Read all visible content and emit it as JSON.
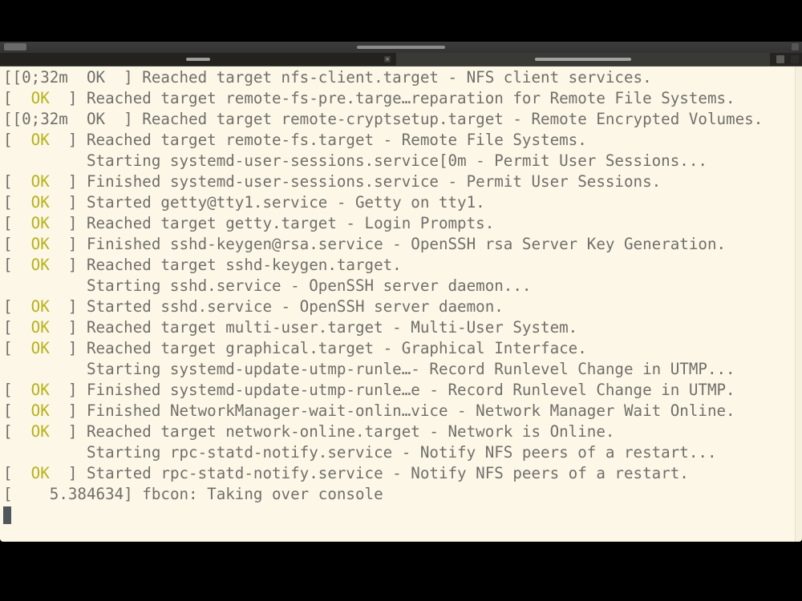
{
  "window": {
    "title": "",
    "tabs": [
      {
        "label": "",
        "active": true
      },
      {
        "label": "",
        "active": false
      }
    ]
  },
  "terminal": {
    "colors": {
      "background": "#fdf7e7",
      "text": "#6f6f6a",
      "ok": "#b6b21c",
      "cursor": "#4f585c"
    },
    "lines": [
      {
        "prefix": "[[0;32m  OK  ] ",
        "ok": "",
        "text": "Reached target nfs-client.target - NFS client services."
      },
      {
        "prefix": "[  ",
        "ok": "OK",
        "text": "  ] Reached target remote-fs-pre.targe…reparation for Remote File Systems."
      },
      {
        "prefix": "[[0;32m  OK  ] ",
        "ok": "",
        "text": "Reached target remote-cryptsetup.target - Remote Encrypted Volumes."
      },
      {
        "prefix": "[  ",
        "ok": "OK",
        "text": "  ] Reached target remote-fs.target - Remote File Systems."
      },
      {
        "prefix": "         ",
        "ok": "",
        "text": "Starting systemd-user-sessions.service[0m - Permit User Sessions..."
      },
      {
        "prefix": "[  ",
        "ok": "OK",
        "text": "  ] Finished systemd-user-sessions.service - Permit User Sessions."
      },
      {
        "prefix": "[  ",
        "ok": "OK",
        "text": "  ] Started getty@tty1.service - Getty on tty1."
      },
      {
        "prefix": "[  ",
        "ok": "OK",
        "text": "  ] Reached target getty.target - Login Prompts."
      },
      {
        "prefix": "[  ",
        "ok": "OK",
        "text": "  ] Finished sshd-keygen@rsa.service - OpenSSH rsa Server Key Generation."
      },
      {
        "prefix": "[  ",
        "ok": "OK",
        "text": "  ] Reached target sshd-keygen.target."
      },
      {
        "prefix": "         ",
        "ok": "",
        "text": "Starting sshd.service - OpenSSH server daemon..."
      },
      {
        "prefix": "[  ",
        "ok": "OK",
        "text": "  ] Started sshd.service - OpenSSH server daemon."
      },
      {
        "prefix": "[  ",
        "ok": "OK",
        "text": "  ] Reached target multi-user.target - Multi-User System."
      },
      {
        "prefix": "[  ",
        "ok": "OK",
        "text": "  ] Reached target graphical.target - Graphical Interface."
      },
      {
        "prefix": "         ",
        "ok": "",
        "text": "Starting systemd-update-utmp-runle…- Record Runlevel Change in UTMP..."
      },
      {
        "prefix": "[  ",
        "ok": "OK",
        "text": "  ] Finished systemd-update-utmp-runle…e - Record Runlevel Change in UTMP."
      },
      {
        "prefix": "[  ",
        "ok": "OK",
        "text": "  ] Finished NetworkManager-wait-onlin…vice - Network Manager Wait Online."
      },
      {
        "prefix": "[  ",
        "ok": "OK",
        "text": "  ] Reached target network-online.target - Network is Online."
      },
      {
        "prefix": "         ",
        "ok": "",
        "text": "Starting rpc-statd-notify.service - Notify NFS peers of a restart..."
      },
      {
        "prefix": "[  ",
        "ok": "OK",
        "text": "  ] Started rpc-statd-notify.service - Notify NFS peers of a restart."
      },
      {
        "prefix": "[    ",
        "ok": "",
        "text": "5.384634] fbcon: Taking over console"
      }
    ]
  }
}
